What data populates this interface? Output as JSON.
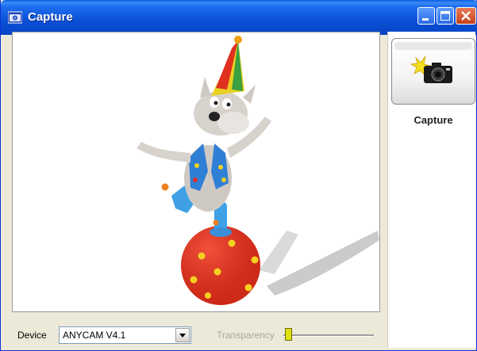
{
  "window": {
    "title": "Capture"
  },
  "title_buttons": {
    "minimize": "minimize-icon",
    "maximize": "maximize-icon",
    "close": "close-icon"
  },
  "capture_button": {
    "label": "Capture",
    "icon": "camera-flash-icon"
  },
  "device": {
    "label": "Device",
    "selected": "ANYCAM V4.1"
  },
  "transparency": {
    "label": "Transparency",
    "value": 0.0
  },
  "colors": {
    "title_blue": "#0a4fd6",
    "close_red": "#c4421a",
    "slider_thumb": "#e0e012"
  }
}
